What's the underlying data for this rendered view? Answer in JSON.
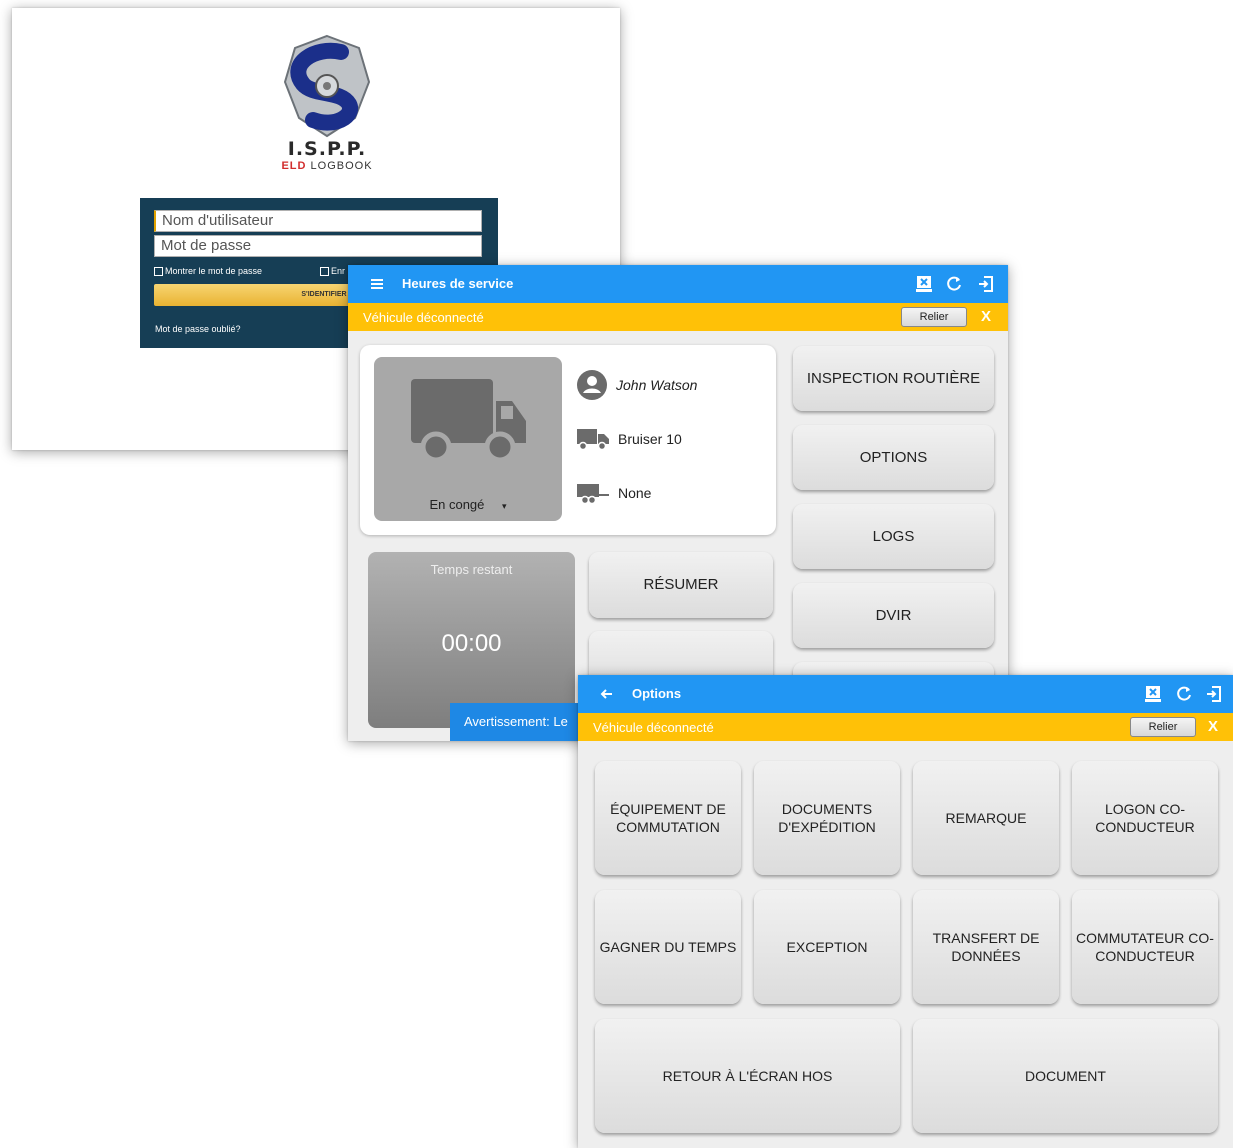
{
  "login": {
    "brand_name": "I.S.P.P.",
    "brand_eld": "ELD",
    "brand_logbook": "LOGBOOK",
    "username_placeholder": "Nom d'utilisateur",
    "password_placeholder": "Mot de passe",
    "show_password": "Montrer le mot de passe",
    "remember_partial": "Enr",
    "login_button": "S'IDENTIFIER",
    "forgot_password": "Mot de passe oublié?"
  },
  "hos": {
    "title": "Heures de service",
    "status_message": "Véhicule déconnecté",
    "connect_button": "Relier",
    "dismiss": "X",
    "driver_name": "John Watson",
    "vehicle": "Bruiser 10",
    "trailer": "None",
    "duty_status": "En congé",
    "time_remaining_label": "Temps restant",
    "time_remaining_value": "00:00",
    "resume_button": "RÉSUMER",
    "menu": [
      "INSPECTION ROUTIÈRE",
      "OPTIONS",
      "LOGS",
      "DVIR"
    ],
    "warning_text": "Avertissement: Le"
  },
  "options": {
    "title": "Options",
    "status_message": "Véhicule déconnecté",
    "connect_button": "Relier",
    "dismiss": "X",
    "buttons": {
      "switching_equipment": "ÉQUIPEMENT DE COMMUTATION",
      "shipping_documents": "DOCUMENTS D'EXPÉDITION",
      "remark": "REMARQUE",
      "codriver_logon": "LOGON CO-CONDUCTEUR",
      "gain_time": "GAGNER DU TEMPS",
      "exception": "EXCEPTION",
      "data_transfer": "TRANSFERT DE DONNÉES",
      "codriver_switch": "COMMUTATEUR CO-CONDUCTEUR",
      "back_to_hos": "RETOUR À L'ÉCRAN HOS",
      "document": "DOCUMENT"
    }
  },
  "colors": {
    "appbar": "#2196f3",
    "statusbar": "#ffc107",
    "login_panel": "#163e55"
  }
}
